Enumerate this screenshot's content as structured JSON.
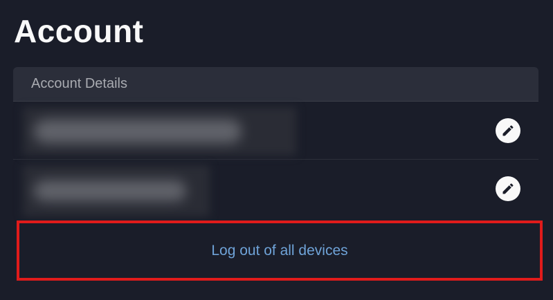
{
  "page": {
    "title": "Account"
  },
  "account_details": {
    "header": "Account Details",
    "rows": [
      {
        "value": "",
        "edit_icon": "pencil-icon"
      },
      {
        "value": "",
        "edit_icon": "pencil-icon"
      }
    ]
  },
  "logout": {
    "label": "Log out of all devices",
    "highlight_color": "#e01b1b",
    "link_color": "#6fa3d8"
  },
  "colors": {
    "background": "#1a1d29",
    "header_bg": "#2b2e3a"
  }
}
